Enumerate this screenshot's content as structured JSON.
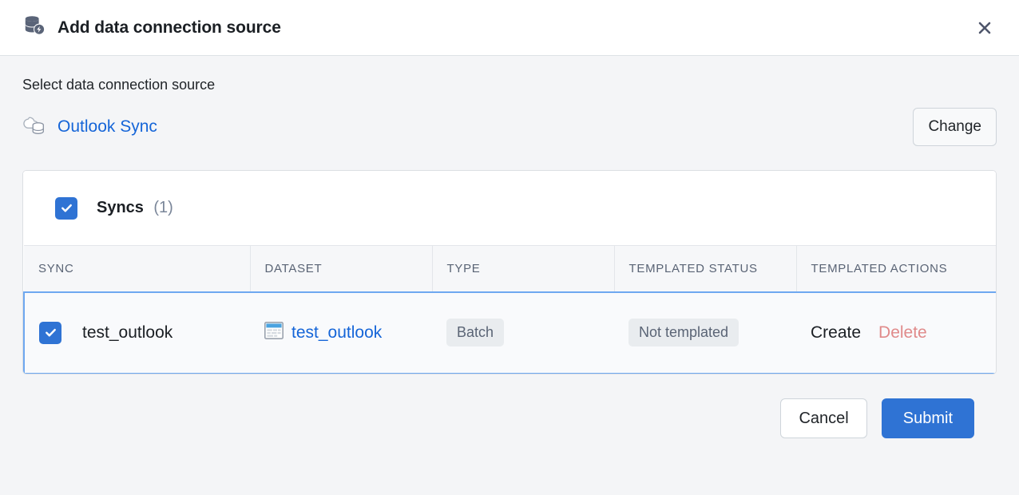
{
  "dialog": {
    "title": "Add data connection source",
    "title_icon": "database-bolt-icon",
    "close_icon": "close-icon"
  },
  "body": {
    "section_label": "Select data connection source",
    "source": {
      "icon": "cloud-database-icon",
      "name": "Outlook Sync",
      "change_label": "Change"
    }
  },
  "card": {
    "header": {
      "checkbox_state": "checked",
      "title": "Syncs",
      "count": "(1)"
    },
    "table": {
      "columns": [
        "SYNC",
        "DATASET",
        "TYPE",
        "TEMPLATED STATUS",
        "TEMPLATED ACTIONS"
      ],
      "rows": [
        {
          "selected": true,
          "checkbox_state": "checked",
          "sync": "test_outlook",
          "dataset": "test_outlook",
          "dataset_icon": "table-icon",
          "type": "Batch",
          "templated_status": "Not templated",
          "action_primary": "Create",
          "action_danger": "Delete"
        }
      ]
    }
  },
  "footer": {
    "cancel_label": "Cancel",
    "submit_label": "Submit"
  },
  "colors": {
    "accent": "#2f73d4",
    "link": "#1565d8",
    "danger": "#e08a8a",
    "page_bg": "#f4f5f7",
    "border": "#dcdfe3"
  }
}
